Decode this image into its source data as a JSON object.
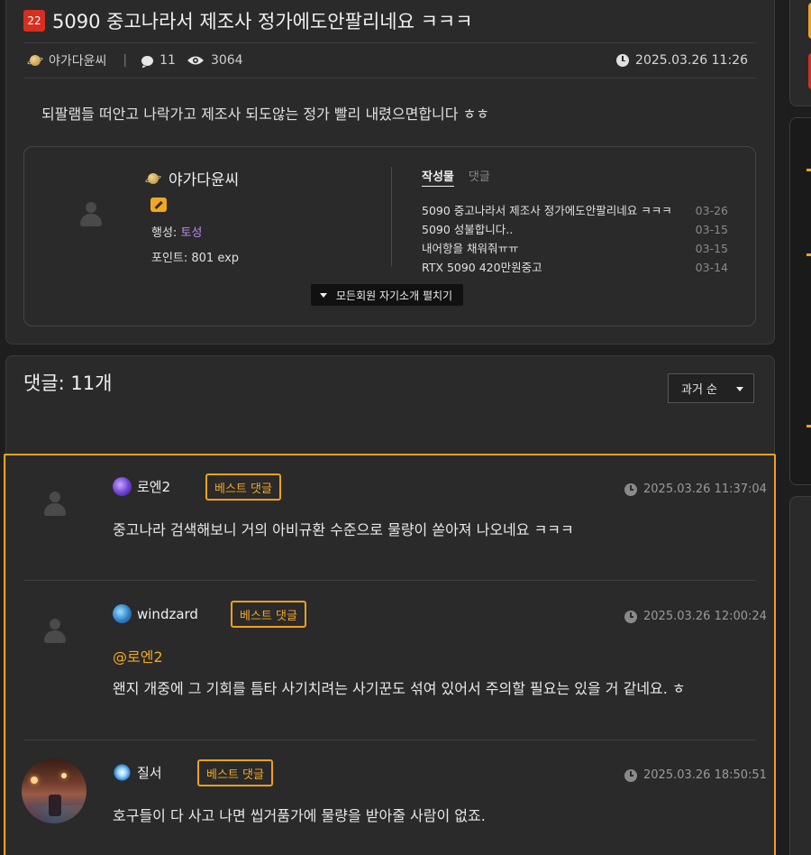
{
  "post": {
    "number_badge": "22",
    "title": "5090 중고나라서 제조사 정가에도안팔리네요 ㅋㅋㅋ",
    "author": "야가다윤씨",
    "separator": "|",
    "comment_count": "11",
    "view_count": "3064",
    "date": "2025.03.26 11:26",
    "body": "되팔램들 떠안고 나락가고 제조사 되도않는 정가 빨리 내렸으면합니다 ㅎㅎ"
  },
  "author_box": {
    "name": "야가다윤씨",
    "planet_label": "행성: ",
    "planet_value": "토성",
    "points_label": "포인트: 801 exp",
    "tab_posts": "작성물",
    "tab_comments": "댓글",
    "recent_posts": [
      {
        "title": "5090 중고나라서 제조사 정가에도안팔리네요 ㅋㅋㅋ",
        "date": "03-26"
      },
      {
        "title": "5090 성불합니다..",
        "date": "03-15"
      },
      {
        "title": "내어항을 채워줘ㅠㅠ",
        "date": "03-15"
      },
      {
        "title": "RTX 5090 420만원중고",
        "date": "03-14"
      }
    ],
    "expand_label": "모든회원 자기소개 펼치기"
  },
  "comments": {
    "title": "댓글: 11개",
    "sort_selected": "과거 순",
    "best_label": "베스트 댓글",
    "items": [
      {
        "author": "로엔2",
        "date": "2025.03.26 11:37:04",
        "mention": "",
        "text": "중고나라 검색해보니 거의 아비규환 수준으로 물량이 쏟아져 나오네요 ㅋㅋㅋ"
      },
      {
        "author": "windzard",
        "date": "2025.03.26 12:00:24",
        "mention": "@로엔2",
        "text": "왠지 개중에 그 기회를 틈타 사기치려는 사기꾼도 섞여 있어서 주의할 필요는 있을 거 같네요. ㅎ"
      },
      {
        "author": "질서",
        "date": "2025.03.26 18:50:51",
        "mention": "",
        "text": "호구들이 다 사고 나면 씹거품가에 물량을 받아줄 사람이 없죠."
      }
    ]
  },
  "colors": {
    "accent_orange": "#f0a020",
    "badge_red": "#d62f20",
    "planet_purple": "#b98bf0"
  }
}
